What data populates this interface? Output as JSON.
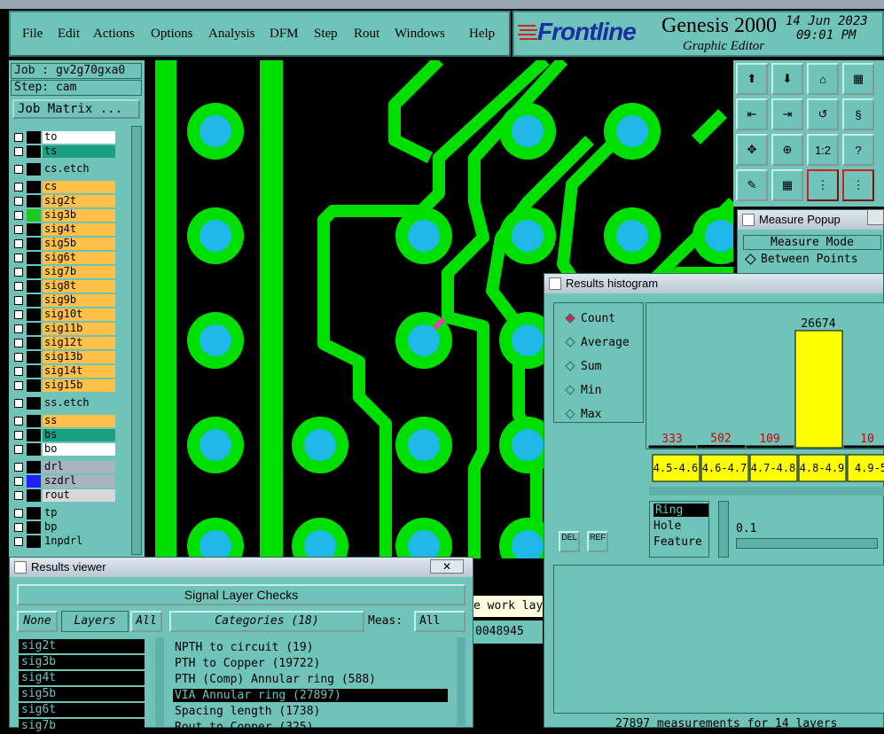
{
  "menubar": {
    "items": [
      "File",
      "Edit",
      "Actions",
      "Options",
      "Analysis",
      "DFM",
      "Step",
      "Rout",
      "Windows",
      "Help"
    ]
  },
  "brand": {
    "logo": "Frontline",
    "app": "Genesis 2000",
    "subtitle": "Graphic Editor",
    "date": "14 Jun 2023",
    "time": "09:01 PM"
  },
  "left": {
    "job": "Job : gv2g70gxa0",
    "step": "Step: cam",
    "job_matrix": "Job Matrix ...",
    "layers": [
      {
        "name": "to",
        "color": "#ffffff",
        "mark": "#000000"
      },
      {
        "name": "ts",
        "color": "#1aa080",
        "mark": "#000000"
      },
      {
        "name": "cs.etch",
        "color": "#6fc3b9",
        "mark": "#000000"
      },
      {
        "name": "cs",
        "color": "#ffc04a",
        "mark": "#000000"
      },
      {
        "name": "sig2t",
        "color": "#ffc04a",
        "mark": "#000000"
      },
      {
        "name": "sig3b",
        "color": "#ffc04a",
        "mark": "#1ec81e"
      },
      {
        "name": "sig4t",
        "color": "#ffc04a",
        "mark": "#000000"
      },
      {
        "name": "sig5b",
        "color": "#ffc04a",
        "mark": "#000000"
      },
      {
        "name": "sig6t",
        "color": "#ffc04a",
        "mark": "#000000"
      },
      {
        "name": "sig7b",
        "color": "#ffc04a",
        "mark": "#000000"
      },
      {
        "name": "sig8t",
        "color": "#ffc04a",
        "mark": "#000000"
      },
      {
        "name": "sig9b",
        "color": "#ffc04a",
        "mark": "#000000"
      },
      {
        "name": "sig10t",
        "color": "#ffc04a",
        "mark": "#000000"
      },
      {
        "name": "sig11b",
        "color": "#ffc04a",
        "mark": "#000000"
      },
      {
        "name": "sig12t",
        "color": "#ffc04a",
        "mark": "#000000"
      },
      {
        "name": "sig13b",
        "color": "#ffc04a",
        "mark": "#000000"
      },
      {
        "name": "sig14t",
        "color": "#ffc04a",
        "mark": "#000000"
      },
      {
        "name": "sig15b",
        "color": "#ffc04a",
        "mark": "#000000"
      },
      {
        "name": "ss.etch",
        "color": "#6fc3b9",
        "mark": "#000000"
      },
      {
        "name": "ss",
        "color": "#ffc04a",
        "mark": "#000000"
      },
      {
        "name": "bs",
        "color": "#1aa080",
        "mark": "#000000"
      },
      {
        "name": "bo",
        "color": "#ffffff",
        "mark": "#000000"
      },
      {
        "name": "drl",
        "color": "#a9b4bf",
        "mark": "#000000"
      },
      {
        "name": "szdrl",
        "color": "#a9b4bf",
        "mark": "#2020ff"
      },
      {
        "name": "rout",
        "color": "#d8d8d8",
        "mark": "#000000"
      },
      {
        "name": "tp",
        "color": "#6fc3b9",
        "mark": "#000000"
      },
      {
        "name": "bp",
        "color": "#6fc3b9",
        "mark": "#000000"
      },
      {
        "name": "1npdrl",
        "color": "#6fc3b9",
        "mark": "#000000"
      }
    ]
  },
  "canvas": {
    "work_layer_hint": "e work laye",
    "coord": "0048945"
  },
  "tools": {
    "labels": [
      "1:2",
      "?"
    ]
  },
  "measure": {
    "title": "Measure Popup",
    "mode_label": "Measure Mode",
    "mode_value": "Between Points"
  },
  "histogram": {
    "title": "Results histogram",
    "modes": [
      "Count",
      "Average",
      "Sum",
      "Min",
      "Max"
    ],
    "selected": "Count",
    "options": [
      "Ring",
      "Hole",
      "Feature"
    ],
    "value": "0.1",
    "del": "DEL",
    "ref": "REF",
    "status": "27897 measurements for 14 layers"
  },
  "chart_data": {
    "type": "bar",
    "categories": [
      "4.5-4.6",
      "4.6-4.7",
      "4.7-4.8",
      "4.8-4.9",
      "4.9-5"
    ],
    "values": [
      333,
      502,
      109,
      26674,
      10
    ],
    "highlight": "4.8-4.9"
  },
  "results": {
    "title": "Results viewer",
    "header": "Signal Layer Checks",
    "none": "None",
    "layers_label": "Layers",
    "all": "All",
    "categories_label": "Categories (18)",
    "meas_label": "Meas:",
    "meas_value": "All",
    "layer_list": [
      "sig2t",
      "sig3b",
      "sig4t",
      "sig5b",
      "sig6t",
      "sig7b"
    ],
    "categories": [
      "NPTH to circuit (19)",
      "PTH to Copper (19722)",
      "PTH (Comp) Annular ring (588)",
      "VIA Annular ring (27897)",
      "Spacing length (1738)",
      "Rout to Copper (325)"
    ],
    "selected_category": "VIA Annular ring (27897)"
  },
  "colors": {
    "teal": "#6fc3b9",
    "copper": "#00e000",
    "drill": "#20b8e8",
    "bar": "#ffff00"
  }
}
